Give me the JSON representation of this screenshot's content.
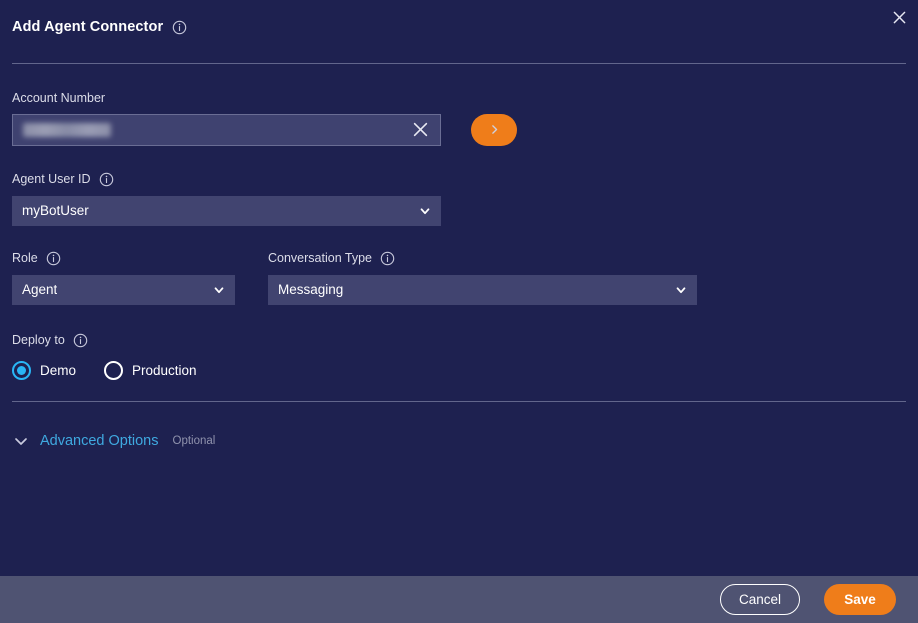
{
  "colors": {
    "background": "#1e2150",
    "field_bg": "#414470",
    "input_bg": "#3f4270",
    "accent_orange": "#ef7d1a",
    "accent_blue": "#29b6f6",
    "link_blue": "#3fa9e0",
    "footer_bg": "#4f5372",
    "divider": "#6f7296"
  },
  "header": {
    "title": "Add Agent Connector",
    "info_icon": "info-icon",
    "close_icon": "close-icon"
  },
  "form": {
    "account_number": {
      "label": "Account Number",
      "value": "",
      "placeholder": "",
      "redacted": true,
      "clear_icon": "close-icon",
      "go_button_icon": "chevron-right-icon"
    },
    "agent_user_id": {
      "label": "Agent User ID",
      "info_icon": "info-icon",
      "value": "myBotUser",
      "chevron_icon": "chevron-down-icon"
    },
    "role": {
      "label": "Role",
      "info_icon": "info-icon",
      "value": "Agent",
      "chevron_icon": "chevron-down-icon"
    },
    "conversation_type": {
      "label": "Conversation Type",
      "info_icon": "info-icon",
      "value": "Messaging",
      "chevron_icon": "chevron-down-icon"
    },
    "deploy_to": {
      "label": "Deploy to",
      "info_icon": "info-icon",
      "options": [
        {
          "label": "Demo",
          "selected": true
        },
        {
          "label": "Production",
          "selected": false
        }
      ]
    },
    "advanced_options": {
      "label": "Advanced Options",
      "optional_tag": "Optional",
      "chevron_icon": "chevron-down-icon",
      "expanded": false
    }
  },
  "footer": {
    "cancel_label": "Cancel",
    "save_label": "Save"
  }
}
